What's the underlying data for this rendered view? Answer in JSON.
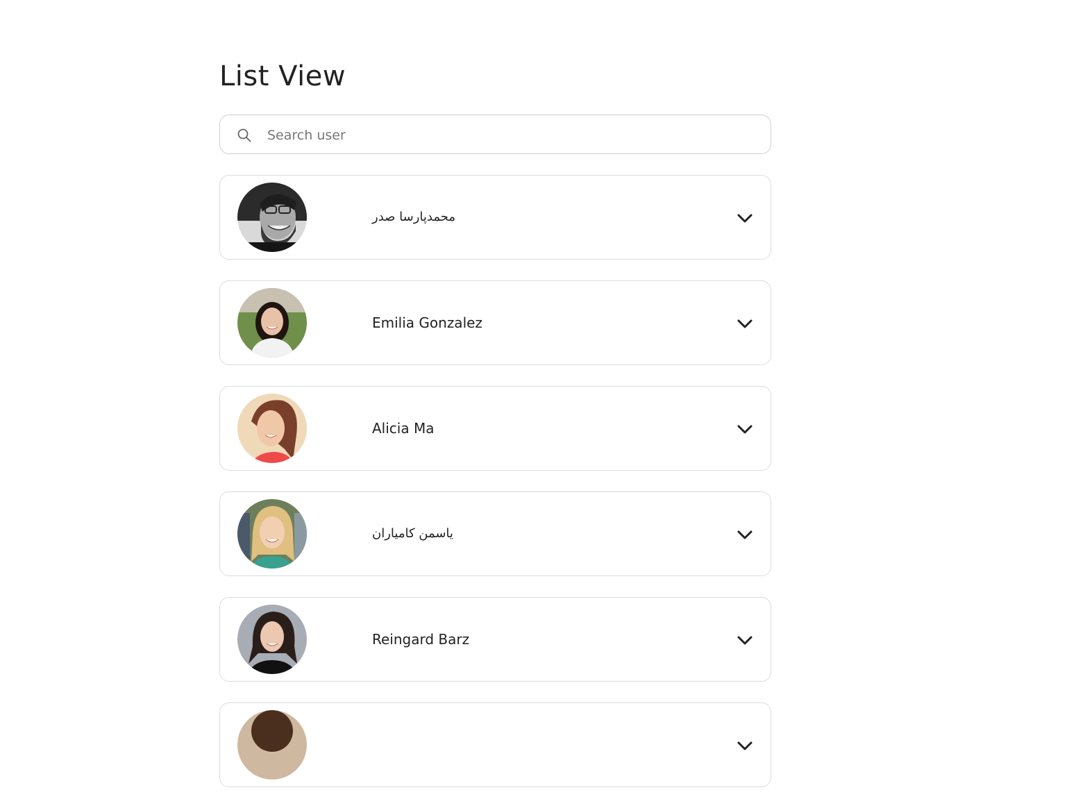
{
  "page": {
    "title": "List View"
  },
  "search": {
    "placeholder": "Search user",
    "value": "",
    "icon": "search-icon"
  },
  "users": [
    {
      "name": "محمدپارسا صدر",
      "rtl": true,
      "avatar_tone": "grayscale",
      "expand_icon": "chevron-down-icon"
    },
    {
      "name": "Emilia Gonzalez",
      "rtl": false,
      "avatar_tone": "green-background",
      "expand_icon": "chevron-down-icon"
    },
    {
      "name": "Alicia Ma",
      "rtl": false,
      "avatar_tone": "warm",
      "expand_icon": "chevron-down-icon"
    },
    {
      "name": "یاسمن کامیاران",
      "rtl": true,
      "avatar_tone": "blonde",
      "expand_icon": "chevron-down-icon"
    },
    {
      "name": "Reingard Barz",
      "rtl": false,
      "avatar_tone": "dark-hair",
      "expand_icon": "chevron-down-icon"
    },
    {
      "name": "",
      "rtl": false,
      "avatar_tone": "partial",
      "expand_icon": "chevron-down-icon"
    }
  ],
  "colors": {
    "text": "#222222",
    "border": "#dcdcdc",
    "placeholder": "#777777"
  }
}
